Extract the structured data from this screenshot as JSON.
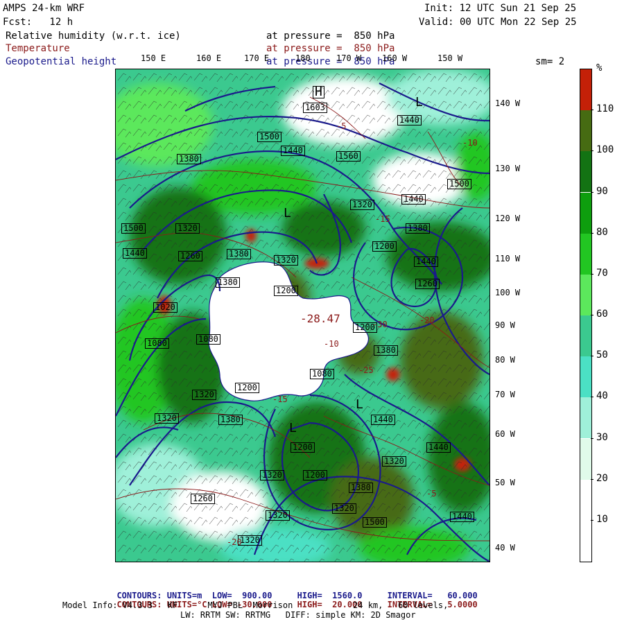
{
  "header": {
    "model": "AMPS 24-km WRF",
    "forecast": "Fcst:   12 h",
    "init": "Init: 12 UTC Sun 21 Sep 25",
    "valid": "Valid: 00 UTC Mon 22 Sep 25",
    "fields": [
      {
        "name": "Relative humidity (w.r.t. ice)",
        "level": "at pressure =  850 hPa",
        "color": "#000000"
      },
      {
        "name": "Temperature",
        "level": "at pressure =  850 hPa",
        "color": "#8b1a1a"
      },
      {
        "name": "Geopotential height",
        "level": "at pressure =  850 hPa",
        "color": "#1a1a8b"
      }
    ],
    "smoothing": "sm= 2"
  },
  "axes": {
    "top_lon_labels": [
      "150 E",
      "160 E",
      "170 E",
      "180",
      "170 W",
      "160 W",
      "150 W"
    ],
    "right_lon_labels": [
      "140 W",
      "130 W",
      "120 W",
      "110 W",
      "100 W",
      "90 W",
      "80 W",
      "70 W",
      "60 W",
      "50 W",
      "40 W"
    ]
  },
  "colorbar": {
    "unit": "%",
    "levels": [
      10,
      20,
      30,
      40,
      50,
      60,
      70,
      80,
      90,
      100,
      110
    ],
    "colors": [
      "#ffffff",
      "#ffffff",
      "#e0fbea",
      "#9ff0d9",
      "#4be0c4",
      "#3bc98f",
      "#5ce85c",
      "#22c622",
      "#0e9e0e",
      "#137313",
      "#466b12",
      "#c42008"
    ]
  },
  "map_labels": {
    "heights": [
      "1603",
      "1440",
      "1560",
      "1440",
      "1500",
      "1380",
      "1440",
      "1500",
      "1320",
      "1380",
      "1440",
      "1200",
      "1440",
      "1260",
      "1380",
      "1500",
      "1320",
      "1380",
      "1320",
      "1200",
      "1200",
      "1020",
      "1080",
      "1080",
      "1200",
      "1080",
      "1260",
      "1320",
      "1380",
      "1320",
      "1440",
      "1380",
      "1320",
      "1200",
      "1440",
      "1500",
      "1380",
      "1320",
      "1260",
      "1320",
      "1200",
      "1320",
      "1440",
      "1320"
    ],
    "temps": [
      "-28.47",
      "-5",
      "-10",
      "-15",
      "-20",
      "-30",
      "-25",
      "-5",
      "-15",
      "-10",
      "-20"
    ],
    "highs_lows": [
      "H",
      "L",
      "L",
      "L",
      "L"
    ]
  },
  "footer": {
    "contours_height": {
      "label": "CONTOURS:",
      "units": "UNITS=m",
      "low": "LOW=  900.00",
      "high": "HIGH=  1560.0",
      "interval": "INTERVAL=   60.000"
    },
    "contours_temp": {
      "label": "CONTOURS:",
      "units": "UNITS=°C",
      "low": "LOW= -30.000",
      "high": "HIGH=  20.000",
      "interval": "INTERVAL=   5.0000"
    },
    "model_info_1": "Model Info: V4.3.3   KF      MYJ PBL  Morrison            24 km,   60 levels,",
    "model_info_2": "LW: RRTM SW: RRTMG   DIFF: simple KM: 2D Smagor"
  }
}
